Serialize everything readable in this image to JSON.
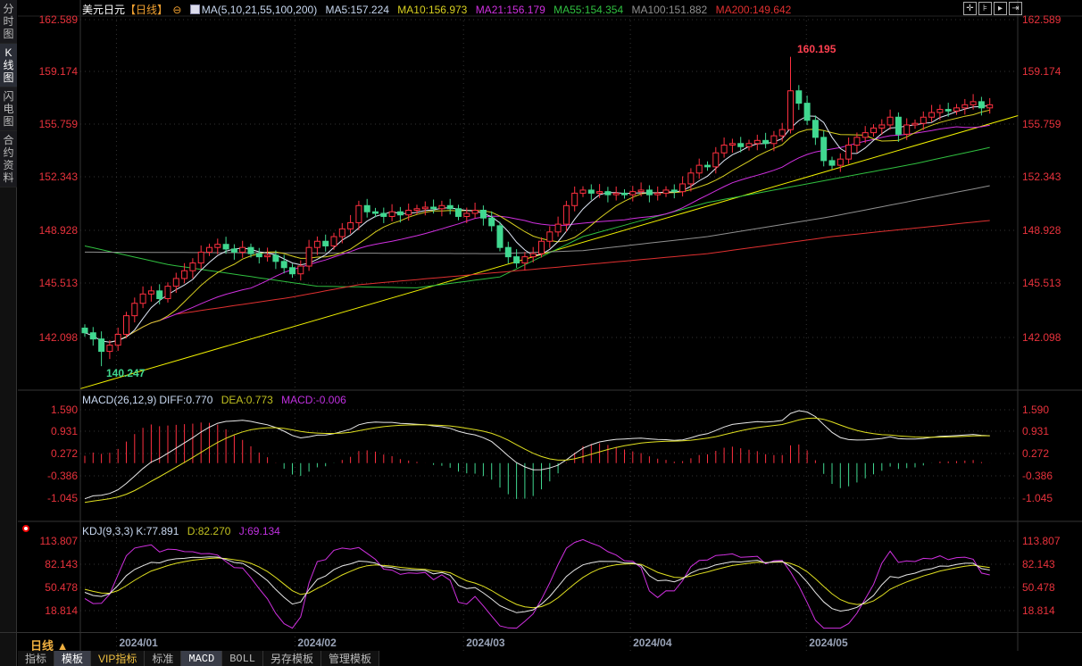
{
  "sidebar": {
    "tabs": [
      {
        "label": "分时图"
      },
      {
        "label": "K线图",
        "active": true
      },
      {
        "label": "闪电图"
      },
      {
        "label": "合约资料"
      }
    ]
  },
  "header": {
    "title": "美元日元",
    "period_tag": "【日线】",
    "ma_label": "MA(5,10,21,55,100,200)",
    "ma": [
      {
        "label": "MA5:157.224",
        "color": "#c8d8f0"
      },
      {
        "label": "MA10:156.973",
        "color": "#d8d020"
      },
      {
        "label": "MA21:156.179",
        "color": "#d030e0"
      },
      {
        "label": "MA55:154.354",
        "color": "#30c040"
      },
      {
        "label": "MA100:151.882",
        "color": "#909090"
      },
      {
        "label": "MA200:149.642",
        "color": "#e03030"
      }
    ]
  },
  "toolbar_icons": [
    "crosshair-icon",
    "zoom-fit-icon",
    "play-forward-icon",
    "move-right-icon"
  ],
  "price_axis": [
    "162.589",
    "159.174",
    "155.759",
    "152.343",
    "148.928",
    "145.513",
    "142.098"
  ],
  "macd": {
    "label": "MACD(26,12,9)",
    "diff": "DIFF:0.770",
    "dea": "DEA:0.773",
    "macd": "MACD:-0.006",
    "axis": [
      "1.590",
      "0.931",
      "0.272",
      "-0.386",
      "-1.045"
    ]
  },
  "kdj": {
    "label": "KDJ(9,3,3)",
    "k": "K:77.891",
    "d": "D:82.270",
    "j": "J:69.134",
    "axis": [
      "113.807",
      "82.143",
      "50.478",
      "18.814"
    ]
  },
  "period": "日线 ▲",
  "bottom_tabs": [
    "指标",
    "模板",
    "VIP指标",
    "标准",
    "MACD",
    "BOLL",
    "另存模板",
    "管理模板"
  ],
  "colors": {
    "up": "#ff3040",
    "down": "#40d890",
    "axis": "#e8323c"
  },
  "chart_data": {
    "type": "candlestick",
    "title": "美元日元 日线",
    "x_ticks": [
      {
        "label": "2024/01",
        "index": 6.5
      },
      {
        "label": "2024/02",
        "index": 28
      },
      {
        "label": "2024/03",
        "index": 48.3
      },
      {
        "label": "2024/04",
        "index": 68.4
      },
      {
        "label": "2024/05",
        "index": 89.6
      }
    ],
    "ylim": [
      138.5,
      162.589
    ],
    "closes": [
      142.4,
      142.0,
      141.2,
      141.6,
      142.3,
      143.5,
      144.3,
      144.9,
      145.1,
      144.6,
      145.4,
      145.9,
      146.4,
      146.9,
      147.6,
      147.9,
      148.1,
      147.8,
      147.6,
      147.9,
      147.5,
      147.3,
      147.4,
      147.0,
      146.6,
      146.2,
      146.7,
      147.9,
      148.3,
      148.0,
      148.6,
      149.1,
      149.5,
      150.6,
      150.2,
      150.1,
      149.9,
      150.2,
      150.0,
      150.3,
      150.4,
      150.5,
      150.4,
      150.6,
      150.4,
      149.9,
      150.1,
      150.3,
      149.8,
      149.3,
      147.9,
      147.3,
      146.9,
      147.3,
      147.5,
      148.3,
      148.9,
      149.4,
      150.6,
      151.4,
      151.6,
      151.4,
      151.5,
      151.3,
      151.4,
      151.3,
      151.5,
      151.6,
      151.3,
      151.4,
      151.6,
      151.5,
      152.0,
      152.7,
      153.2,
      153.1,
      154.0,
      154.5,
      154.6,
      154.4,
      154.6,
      154.8,
      154.6,
      155.1,
      155.5,
      158.0,
      157.2,
      156.1,
      155.0,
      153.5,
      153.2,
      153.6,
      154.5,
      155.0,
      155.3,
      155.6,
      155.8,
      156.3,
      155.2,
      155.8,
      155.9,
      156.3,
      156.6,
      156.8,
      156.7,
      156.9,
      157.1,
      157.3,
      156.9,
      157.1
    ],
    "high_mark": {
      "index": 85,
      "value": 160.195,
      "label": "160.195"
    },
    "low_mark": {
      "index": 2,
      "value": 140.247,
      "label": "140.247"
    },
    "ma_lines": [
      {
        "name": "MA55",
        "color": "#30c040",
        "points": [
          [
            0,
            148
          ],
          [
            10,
            146.8
          ],
          [
            28,
            145.4
          ],
          [
            40,
            145.3
          ],
          [
            50,
            146
          ],
          [
            60,
            148.6
          ],
          [
            75,
            150.8
          ],
          [
            90,
            152.3
          ],
          [
            100,
            153.3
          ],
          [
            109,
            154.35
          ]
        ]
      },
      {
        "name": "MA100",
        "color": "#909090",
        "points": [
          [
            0,
            147.6
          ],
          [
            50,
            147.5
          ],
          [
            60,
            147.7
          ],
          [
            75,
            148.6
          ],
          [
            90,
            149.9
          ],
          [
            109,
            151.88
          ]
        ]
      },
      {
        "name": "MA200",
        "color": "#e03030",
        "points": [
          [
            11,
            143.6
          ],
          [
            25,
            144.7
          ],
          [
            33,
            145.5
          ],
          [
            50,
            146.3
          ],
          [
            75,
            147.5
          ],
          [
            90,
            148.6
          ],
          [
            109,
            149.64
          ]
        ]
      }
    ],
    "trendline": {
      "color": "#f0f000",
      "points": [
        [
          -0.5,
          138.8
        ],
        [
          112.4,
          156.4
        ]
      ]
    },
    "macd_ylim": [
      -1.3,
      1.7
    ],
    "kdj_ylim": [
      0,
      120
    ]
  }
}
